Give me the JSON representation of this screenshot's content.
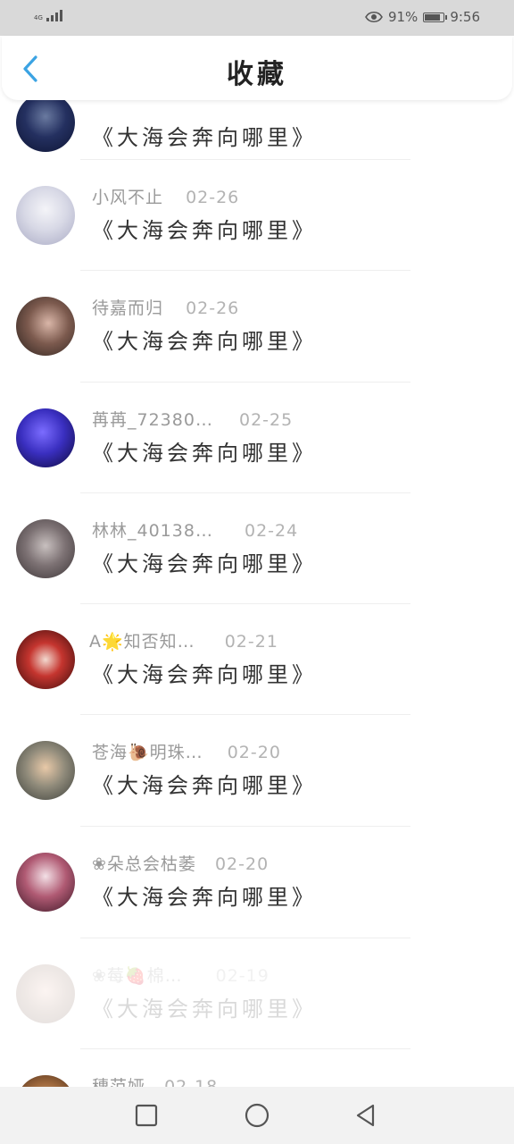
{
  "status_bar": {
    "network": "4G",
    "battery_percent": "91%",
    "battery_level": 0.91,
    "time": "9:56"
  },
  "header": {
    "title": "收藏",
    "back_icon": "chevron-left-icon"
  },
  "list": {
    "items": [
      {
        "author": "",
        "date": "",
        "title": "《大海会奔向哪里》"
      },
      {
        "author": "小风不止",
        "date": "02-26",
        "title": "《大海会奔向哪里》"
      },
      {
        "author": "待嘉而归",
        "date": "02-26",
        "title": "《大海会奔向哪里》"
      },
      {
        "author": "苒苒_72380…",
        "date": "02-25",
        "title": "《大海会奔向哪里》"
      },
      {
        "author": "林林_40138…",
        "date": "02-24",
        "title": "《大海会奔向哪里》"
      },
      {
        "author": "A🌟知否知…",
        "date": "02-21",
        "title": "《大海会奔向哪里》"
      },
      {
        "author": "苍海🐌明珠…",
        "date": "02-20",
        "title": "《大海会奔向哪里》"
      },
      {
        "author": "❀朵总会枯萎",
        "date": "02-20",
        "title": "《大海会奔向哪里》"
      },
      {
        "author": "❀莓🍓棉…",
        "date": "02-19",
        "title": "《大海会奔向哪里》"
      },
      {
        "author": "穗范娅",
        "date": "02-18",
        "title": ""
      }
    ]
  },
  "nav_bar": {
    "icons": [
      "square-icon",
      "circle-icon",
      "triangle-back-icon"
    ]
  }
}
